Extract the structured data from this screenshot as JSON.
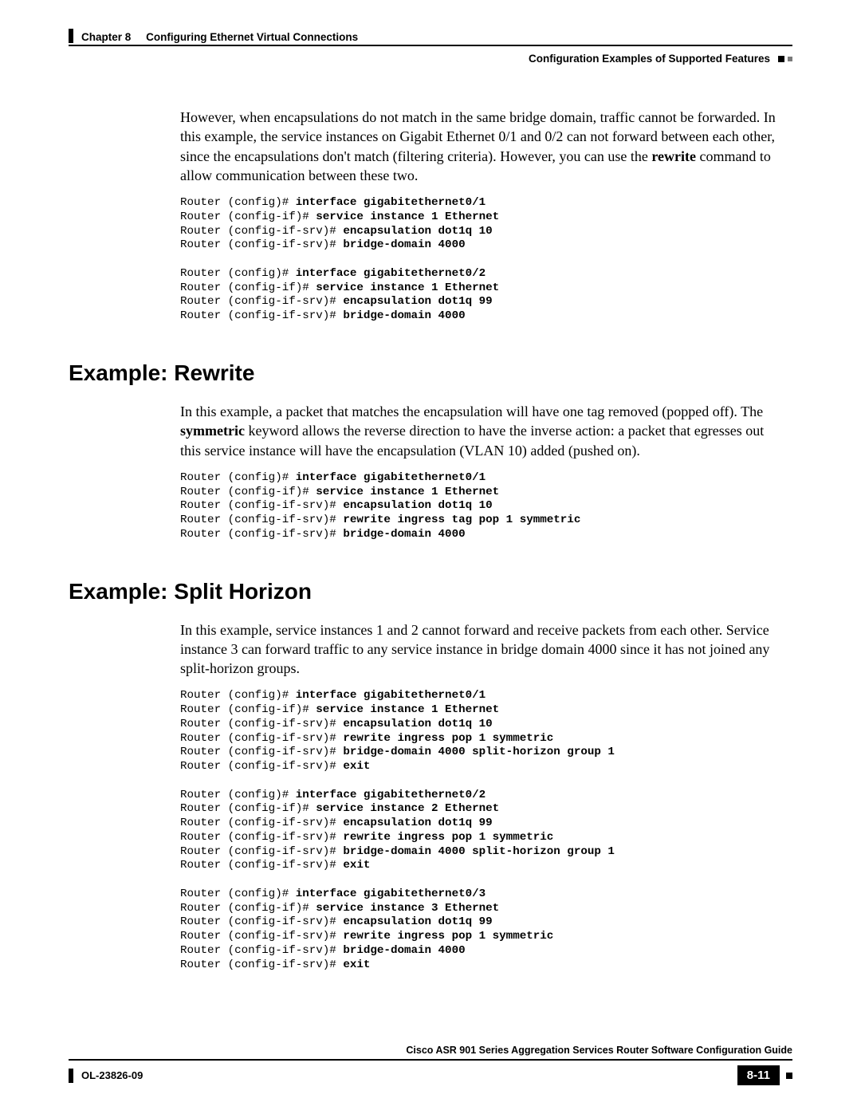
{
  "header": {
    "chapter_label": "Chapter 8",
    "chapter_title": "Configuring Ethernet Virtual Connections",
    "section_title": "Configuration Examples of Supported Features"
  },
  "intro": {
    "p1_a": "However, when encapsulations do not match in the same bridge domain, traffic cannot be forwarded. In this example, the service instances on Gigabit Ethernet 0/1 and 0/2 can not forward between each other, since the encapsulations don't match (filtering criteria). However, you can use the ",
    "p1_b": "rewrite",
    "p1_c": " command to allow communication between these two."
  },
  "code1": [
    {
      "p": "Router (config)# ",
      "c": "interface gigabitethernet0/1"
    },
    {
      "p": "Router (config-if)# ",
      "c": "service instance 1 Ethernet"
    },
    {
      "p": "Router (config-if-srv)# ",
      "c": "encapsulation dot1q 10"
    },
    {
      "p": "Router (config-if-srv)# ",
      "c": "bridge-domain 4000"
    },
    {
      "p": "",
      "c": ""
    },
    {
      "p": "Router (config)# ",
      "c": "interface gigabitethernet0/2"
    },
    {
      "p": "Router (config-if)# ",
      "c": "service instance 1 Ethernet"
    },
    {
      "p": "Router (config-if-srv)# ",
      "c": "encapsulation dot1q 99"
    },
    {
      "p": "Router (config-if-srv)# ",
      "c": "bridge-domain 4000"
    }
  ],
  "section_rewrite": {
    "heading": "Example: Rewrite",
    "p_a": "In this example, a packet that matches the encapsulation will have one tag removed (popped off). The ",
    "p_b": "symmetric",
    "p_c": " keyword allows the reverse direction to have the inverse action: a packet that egresses out this service instance will have the encapsulation (VLAN 10) added (pushed on)."
  },
  "code2": [
    {
      "p": "Router (config)# ",
      "c": "interface gigabitethernet0/1"
    },
    {
      "p": "Router (config-if)# ",
      "c": "service instance 1 Ethernet"
    },
    {
      "p": "Router (config-if-srv)# ",
      "c": "encapsulation dot1q 10"
    },
    {
      "p": "Router (config-if-srv)# ",
      "c": "rewrite ingress tag pop 1 symmetric"
    },
    {
      "p": "Router (config-if-srv)# ",
      "c": "bridge-domain 4000"
    }
  ],
  "section_split": {
    "heading": "Example: Split Horizon",
    "p": "In this example, service instances 1 and 2 cannot forward and receive packets from each other. Service instance 3 can forward traffic to any service instance in bridge domain 4000 since it has not joined any split-horizon groups."
  },
  "code3": [
    {
      "p": "Router (config)# ",
      "c": "interface gigabitethernet0/1"
    },
    {
      "p": "Router (config-if)# ",
      "c": "service instance 1 Ethernet"
    },
    {
      "p": "Router (config-if-srv)# ",
      "c": "encapsulation dot1q 10"
    },
    {
      "p": "Router (config-if-srv)# ",
      "c": "rewrite ingress pop 1 symmetric"
    },
    {
      "p": "Router (config-if-srv)# ",
      "c": "bridge-domain 4000 split-horizon group 1"
    },
    {
      "p": "Router (config-if-srv)# ",
      "c": "exit"
    },
    {
      "p": "",
      "c": ""
    },
    {
      "p": "Router (config)# ",
      "c": "interface gigabitethernet0/2"
    },
    {
      "p": "Router (config-if)# ",
      "c": "service instance 2 Ethernet"
    },
    {
      "p": "Router (config-if-srv)# ",
      "c": "encapsulation dot1q 99"
    },
    {
      "p": "Router (config-if-srv)# ",
      "c": "rewrite ingress pop 1 symmetric"
    },
    {
      "p": "Router (config-if-srv)# ",
      "c": "bridge-domain 4000 split-horizon group 1"
    },
    {
      "p": "Router (config-if-srv)# ",
      "c": "exit"
    },
    {
      "p": "",
      "c": ""
    },
    {
      "p": "Router (config)# ",
      "c": "interface gigabitethernet0/3"
    },
    {
      "p": "Router (config-if)# ",
      "c": "service instance 3 Ethernet"
    },
    {
      "p": "Router (config-if-srv)# ",
      "c": "encapsulation dot1q 99"
    },
    {
      "p": "Router (config-if-srv)# ",
      "c": "rewrite ingress pop 1 symmetric"
    },
    {
      "p": "Router (config-if-srv)# ",
      "c": "bridge-domain 4000"
    },
    {
      "p": "Router (config-if-srv)# ",
      "c": "exit"
    }
  ],
  "footer": {
    "book_title": "Cisco ASR 901 Series Aggregation Services Router Software Configuration Guide",
    "doc_id": "OL-23826-09",
    "page_number": "8-11"
  }
}
